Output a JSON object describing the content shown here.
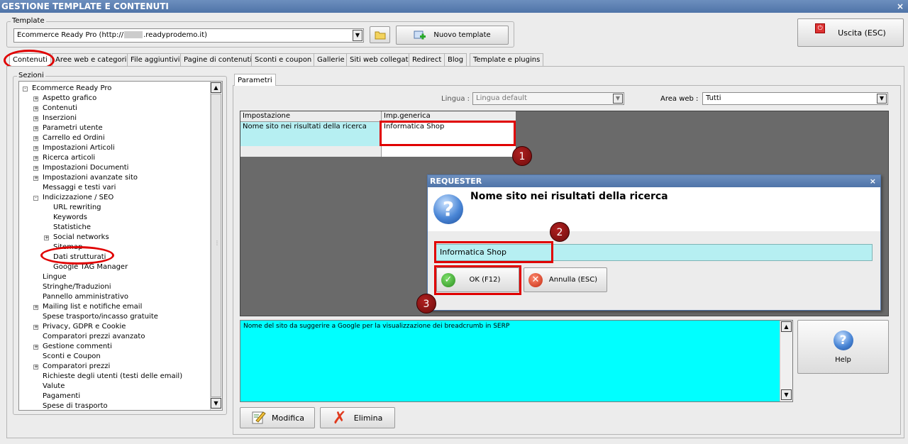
{
  "window": {
    "title": "GESTIONE TEMPLATE E CONTENUTI",
    "close": "×"
  },
  "template": {
    "legend": "Template",
    "value": "Ecommerce Ready Pro (http://",
    "value_suffix": ".readyprodemo.it)",
    "new_button": "Nuovo template"
  },
  "exit_button": "Uscita (ESC)",
  "tabs": [
    "Contenuti",
    "Aree web e categorie",
    "File aggiuntivi",
    "Pagine di contenuti",
    "Sconti e coupon",
    "Gallerie",
    "Siti web collegati",
    "Redirect",
    "Blog",
    "Template e plugins"
  ],
  "sections": {
    "legend": "Sezioni",
    "items": [
      "Ecommerce Ready Pro",
      "Aspetto grafico",
      "Contenuti",
      "Inserzioni",
      "Parametri utente",
      "Carrello ed Ordini",
      "Impostazioni Articoli",
      "Ricerca articoli",
      "Impostazioni Documenti",
      "Impostazioni avanzate sito",
      "Messaggi e testi vari",
      "Indicizzazione / SEO",
      "URL rewriting",
      "Keywords",
      "Statistiche",
      "Social networks",
      "Sitemap",
      "Dati strutturati",
      "Google TAG Manager",
      "Lingue",
      "Stringhe/Traduzioni",
      "Pannello amministrativo",
      "Mailing list e notifiche email",
      "Spese trasporto/incasso gratuite",
      "Privacy, GDPR e Cookie",
      "Comparatori prezzi avanzato",
      "Gestione commenti",
      "Sconti e Coupon",
      "Comparatori prezzi",
      "Richieste degli utenti (testi delle email)",
      "Valute",
      "Pagamenti",
      "Spese di trasporto"
    ]
  },
  "params": {
    "tab": "Parametri",
    "lingua_label": "Lingua :",
    "lingua_value": "Lingua default",
    "area_label": "Area web :",
    "area_value": "Tutti",
    "col1": "Impostazione",
    "col2": "Imp.generica",
    "row1_setting": "Nome sito nei risultati della ricerca",
    "row1_value": "Informatica Shop",
    "description": "Nome del sito da suggerire a Google per la visualizzazione dei breadcrumb in SERP",
    "help": "Help",
    "modifica": "Modifica",
    "elimina": "Elimina"
  },
  "requester": {
    "title": "REQUESTER",
    "close": "×",
    "heading": "Nome sito nei risultati della ricerca",
    "input_value": "Informatica Shop",
    "ok": "OK (F12)",
    "cancel": "Annulla (ESC)"
  },
  "annotations": [
    "1",
    "2",
    "3"
  ],
  "colors": {
    "accent_red": "#e00000",
    "cyan": "#00ffff",
    "light_cyan": "#b6eff2",
    "grid_dark": "#6a6a6a",
    "titlebar": "#5a7db0"
  }
}
